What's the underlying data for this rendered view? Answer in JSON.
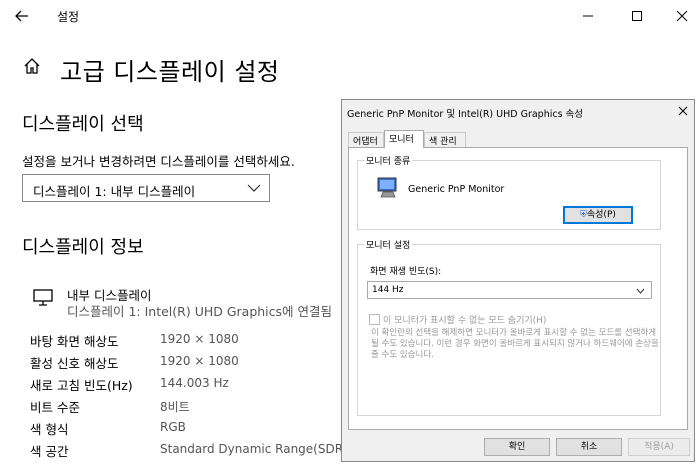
{
  "window": {
    "title": "설정"
  },
  "page": {
    "title": "고급 디스플레이 설정"
  },
  "select_section": {
    "heading": "디스플레이 선택",
    "instruction": "설정을 보거나 변경하려면 디스플레이를 선택하세요.",
    "dropdown_value": "디스플레이 1: 내부 디스플레이"
  },
  "info_section": {
    "heading": "디스플레이 정보",
    "display_name": "내부 디스플레이",
    "display_sub": "디스플레이 1: Intel(R) UHD Graphics에 연결됨",
    "rows": [
      {
        "label": "바탕 화면 해상도",
        "value": "1920 × 1080"
      },
      {
        "label": "활성 신호 해상도",
        "value": "1920 × 1080"
      },
      {
        "label": "새로 고침 빈도(Hz)",
        "value": "144.003 Hz"
      },
      {
        "label": "비트 수준",
        "value": "8비트"
      },
      {
        "label": "색 형식",
        "value": "RGB"
      },
      {
        "label": "색 공간",
        "value": "Standard Dynamic Range(SDR)"
      }
    ]
  },
  "dialog": {
    "title": "Generic PnP Monitor 및 Intel(R) UHD Graphics 속성",
    "tabs": [
      "어댑터",
      "모니터",
      "색 관리"
    ],
    "monitor_type": {
      "group_label": "모니터 종류",
      "monitor_name": "Generic PnP Monitor",
      "properties_button": "속성(P)"
    },
    "monitor_settings": {
      "group_label": "모니터 설정",
      "refresh_label": "화면 재생 빈도(S):",
      "refresh_value": "144 Hz",
      "hide_modes_checkbox": "이 모니터가 표시할 수 없는 모드 숨기기(H)",
      "hide_modes_checked": false,
      "description": "이 확인란의 선택을 해제하면 모니터가 올바르게 표시할 수 없는 모드를 선택하게 될 수도 있습니다. 이런 경우 화면이 올바르게 표시되지 않거나 하드웨어에 손상을 줄 수도 있습니다."
    },
    "buttons": {
      "ok": "확인",
      "cancel": "취소",
      "apply": "적용(A)"
    }
  }
}
